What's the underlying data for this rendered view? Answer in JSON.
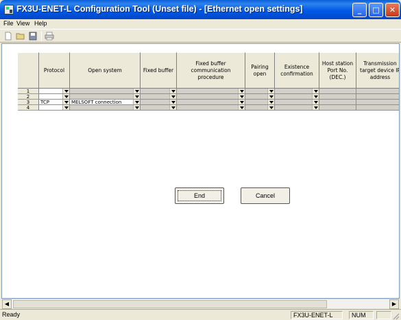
{
  "window": {
    "title": "FX3U-ENET-L Configuration Tool (Unset file) - [Ethernet open settings]"
  },
  "menu": {
    "file": "File",
    "view": "View",
    "help": "Help"
  },
  "toolbar": {
    "icons": [
      "new-file-icon",
      "open-folder-icon",
      "save-icon",
      "print-icon"
    ]
  },
  "table": {
    "headers": {
      "protocol": "Protocol",
      "open_system": "Open system",
      "fixed_buffer": "Fixed buffer",
      "fixed_buffer_procedure": "Fixed buffer\ncommunication\nprocedure",
      "pairing_open": "Pairing\nopen",
      "existence_confirmation": "Existence\nconfirmation",
      "host_port": "Host station\nPort No.\n(DEC.)",
      "target_ip": "Transmission\ntarget device IP\naddress"
    },
    "rows": [
      {
        "num": "1",
        "protocol": "",
        "open_system": ""
      },
      {
        "num": "2",
        "protocol": "",
        "open_system": ""
      },
      {
        "num": "3",
        "protocol": "TCP",
        "open_system": "MELSOFT connection"
      },
      {
        "num": "4",
        "protocol": "",
        "open_system": ""
      }
    ]
  },
  "buttons": {
    "end": "End",
    "cancel": "Cancel"
  },
  "status": {
    "text": "Ready",
    "module": "FX3U-ENET-L",
    "num": "NUM"
  }
}
